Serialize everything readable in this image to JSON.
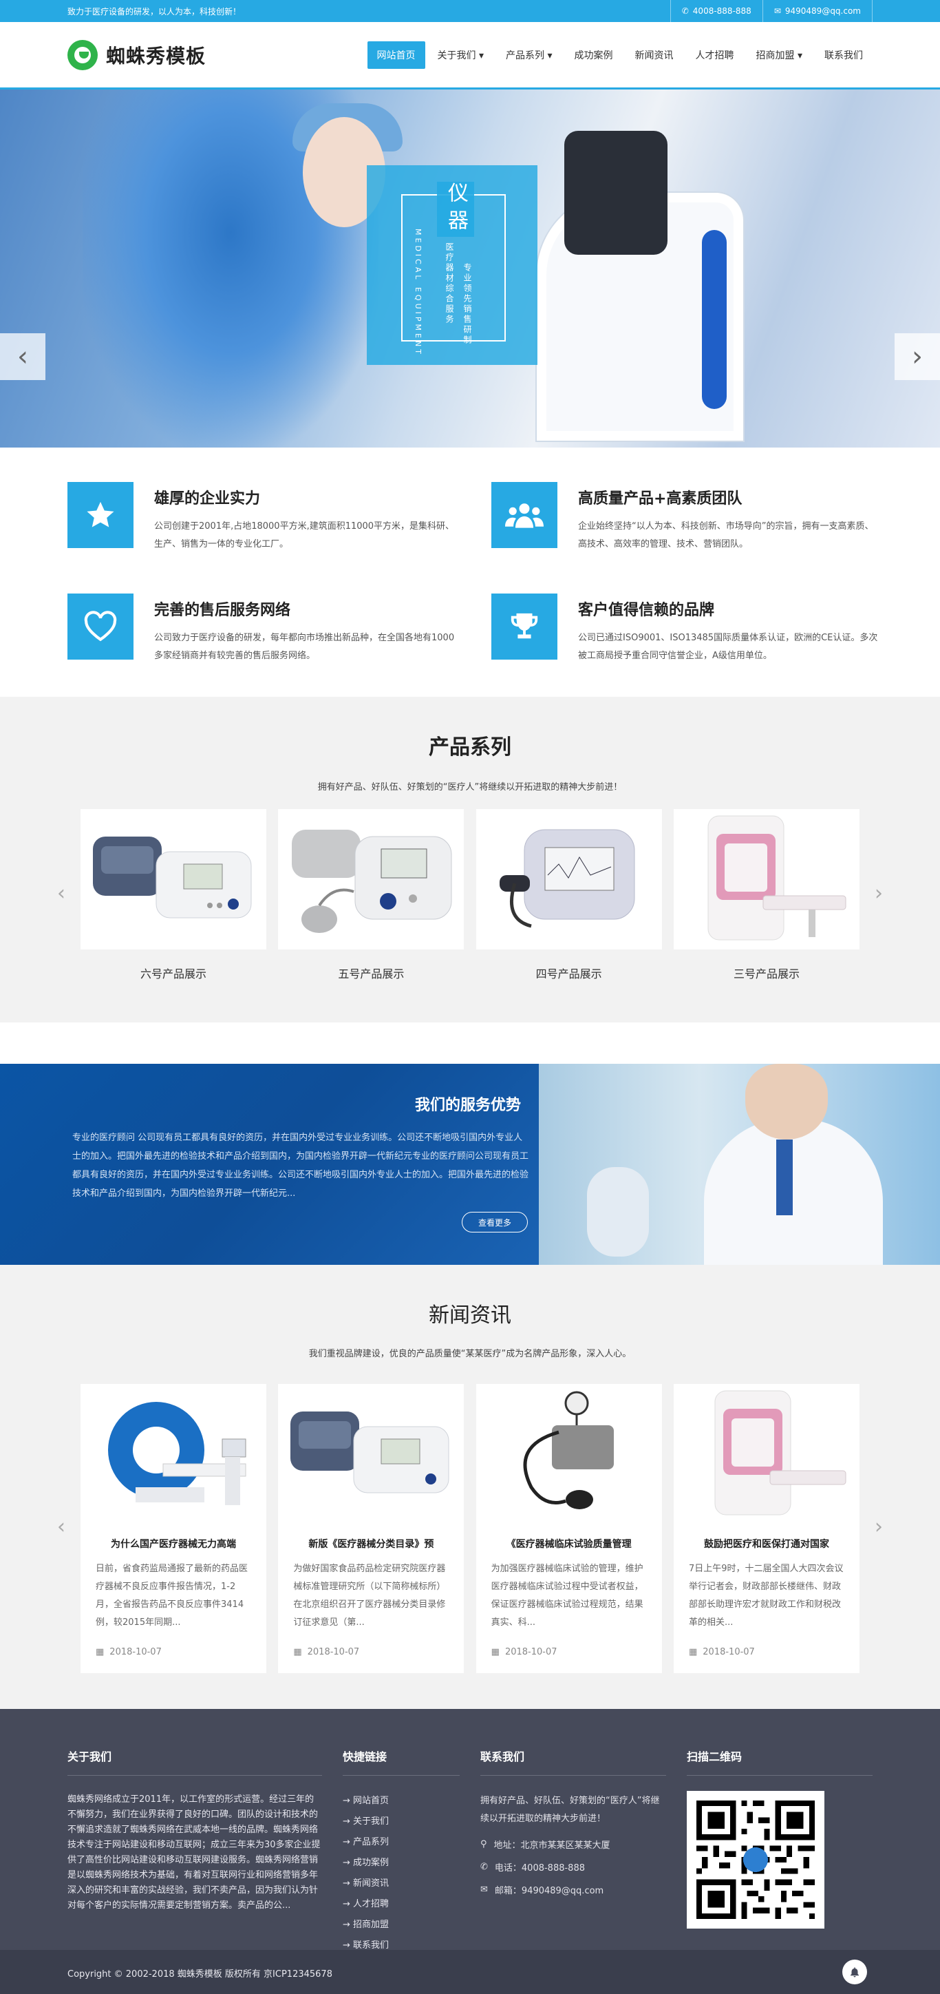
{
  "topbar": {
    "slogan": "致力于医疗设备的研发，以人为本，科技创新！",
    "phone": "4008-888-888",
    "email": "9490489@qq.com"
  },
  "header": {
    "logo_text": "蜘蛛秀模板",
    "nav": [
      {
        "label": "网站首页",
        "active": true
      },
      {
        "label": "关于我们 ▾"
      },
      {
        "label": "产品系列 ▾"
      },
      {
        "label": "成功案例"
      },
      {
        "label": "新闻资讯"
      },
      {
        "label": "人才招聘"
      },
      {
        "label": "招商加盟 ▾"
      },
      {
        "label": "联系我们"
      }
    ]
  },
  "banner": {
    "big_text": "仪器",
    "en_text": "MEDICAL EQUIPMENT",
    "cn_line1": "医疗器材综合服务",
    "cn_line2": "专业领先销售研制"
  },
  "features": [
    {
      "icon": "star-icon",
      "title": "雄厚的企业实力",
      "desc": "公司创建于2001年,占地18000平方米,建筑面积11000平方米，是集科研、生产、销售为一体的专业化工厂。"
    },
    {
      "icon": "team-icon",
      "title": "高质量产品+高素质团队",
      "desc": "企业始终坚持“以人为本、科技创新、市场导向”的宗旨，拥有一支高素质、高技术、高效率的管理、技术、营销团队。"
    },
    {
      "icon": "heart-icon",
      "title": "完善的售后服务网络",
      "desc": "公司致力于医疗设备的研发，每年都向市场推出新品种，在全国各地有1000多家经销商并有较完善的售后服务网络。"
    },
    {
      "icon": "trophy-icon",
      "title": "客户值得信赖的品牌",
      "desc": "公司已通过ISO9001、ISO13485国际质量体系认证，欧洲的CE认证。多次被工商局授予重合同守信誉企业，A级信用单位。"
    }
  ],
  "products": {
    "title": "产品系列",
    "subtitle": "拥有好产品、好队伍、好策划的“医疗人”将继续以开拓进取的精神大步前进！",
    "items": [
      {
        "name": "六号产品展示",
        "img": "blood-pressure-monitor"
      },
      {
        "name": "五号产品展示",
        "img": "bp-monitor-with-bulb"
      },
      {
        "name": "四号产品展示",
        "img": "ecg-device"
      },
      {
        "name": "三号产品展示",
        "img": "pink-cabinet"
      }
    ]
  },
  "service": {
    "title": "我们的服务优势",
    "text": "专业的医疗顾问 公司现有员工都具有良好的资历，并在国内外受过专业业务训练。公司还不断地吸引国内外专业人士的加入。把国外最先进的检验技术和产品介绍到国内，为国内检验界开辟一代新纪元专业的医疗顾问公司现有员工都具有良好的资历，并在国内外受过专业业务训练。公司还不断地吸引国内外专业人士的加入。把国外最先进的检验技术和产品介绍到国内，为国内检验界开辟一代新纪元...",
    "more": "查看更多"
  },
  "news": {
    "title": "新闻资讯",
    "subtitle": "我们重视品牌建设，优良的产品质量使“某某医疗”成为名牌产品形象，深入人心。",
    "items": [
      {
        "title": "为什么国产医疗器械无力高端",
        "desc": "日前，省食药监局通报了最新的药品医疗器械不良反应事件报告情况，1-2月，全省报告药品不良反应事件3414例，较2015年同期...",
        "date": "2018-10-07",
        "img": "ct-scanner"
      },
      {
        "title": "新版《医疗器械分类目录》预",
        "desc": "为做好国家食品药品检定研究院医疗器械标准管理研究所（以下简称械标所）在北京组织召开了医疗器械分类目录修订征求意见（第...",
        "date": "2018-10-07",
        "img": "blood-pressure-monitor"
      },
      {
        "title": "《医疗器械临床试验质量管理",
        "desc": "为加强医疗器械临床试验的管理，维护医疗器械临床试验过程中受试者权益，保证医疗器械临床试验过程规范，结果真实、科...",
        "date": "2018-10-07",
        "img": "sphygmomanometer"
      },
      {
        "title": "鼓励把医疗和医保打通对国家",
        "desc": "7日上午9时，十二届全国人大四次会议举行记者会，财政部部长楼继伟、财政部部长助理许宏才就财政工作和财税改革的相关...",
        "date": "2018-10-07",
        "img": "pink-cabinet"
      }
    ]
  },
  "footer": {
    "about_title": "关于我们",
    "about_text": "蜘蛛秀网络成立于2011年，以工作室的形式运营。经过三年的不懈努力，我们在业界获得了良好的口碑。团队的设计和技术的不懈追求造就了蜘蛛秀网络在武威本地一线的品牌。蜘蛛秀网络技术专注于网站建设和移动互联网；成立三年来为30多家企业提供了高性价比网站建设和移动互联网建设服务。蜘蛛秀网络营销是以蜘蛛秀网络技术为基础，有着对互联网行业和网络营销多年深入的研究和丰富的实战经验，我们不卖产品，因为我们认为针对每个客户的实际情况需要定制营销方案。卖产品的公...",
    "links_title": "快捷链接",
    "links": [
      "→ 网站首页",
      "→ 关于我们",
      "→ 产品系列",
      "→ 成功案例",
      "→ 新闻资讯",
      "→ 人才招聘",
      "→ 招商加盟",
      "→ 联系我们"
    ],
    "contact_title": "联系我们",
    "contact_intro": "拥有好产品、好队伍、好策划的“医疗人”将继续以开拓进取的精神大步前进！",
    "address": "地址：北京市某某区某某大厦",
    "tel": "电话：4008-888-888",
    "mail": "邮箱：9490489@qq.com",
    "qr_title": "扫描二维码",
    "copyright": "Copyright © 2002-2018 蜘蛛秀模板 版权所有 京ICP12345678"
  },
  "colors": {
    "accent": "#27a9e3",
    "footer_bg": "#464a5a",
    "service_bg": "#0e4e98"
  }
}
